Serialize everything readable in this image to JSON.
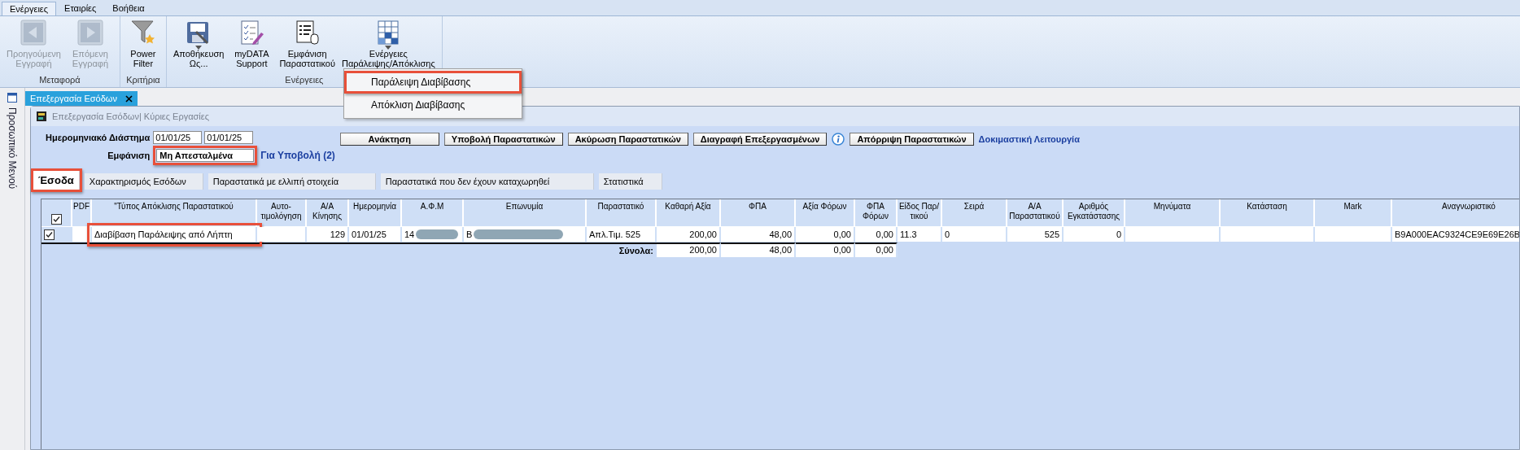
{
  "ribbon": {
    "tabs": [
      {
        "label": "Ενέργειες",
        "selected": true
      },
      {
        "label": "Εταιρίες",
        "selected": false
      },
      {
        "label": "Βοήθεια",
        "selected": false
      }
    ],
    "groups": [
      {
        "label": "Μεταφορά",
        "buttons": [
          {
            "lines": [
              "Προηγούμενη",
              "Εγγραφή"
            ],
            "disabled": true,
            "has_menu": false
          },
          {
            "lines": [
              "Επόμενη",
              "Εγγραφή"
            ],
            "disabled": true,
            "has_menu": false
          }
        ]
      },
      {
        "label": "Κριτήρια",
        "buttons": [
          {
            "lines": [
              "Power",
              "Filter"
            ],
            "disabled": false,
            "has_menu": false
          }
        ]
      },
      {
        "label": "Ενέργειες",
        "buttons": [
          {
            "lines": [
              "Αποθήκευση",
              "Ως..."
            ],
            "disabled": false,
            "has_menu": true
          },
          {
            "lines": [
              "myDATA",
              "Support"
            ],
            "disabled": false,
            "has_menu": false
          },
          {
            "lines": [
              "Εμφάνιση",
              "Παραστατικού"
            ],
            "disabled": false,
            "has_menu": false
          },
          {
            "lines": [
              "Ενέργειες",
              "Παράλειψης/Απόκλισης"
            ],
            "disabled": false,
            "has_menu": true
          }
        ]
      }
    ]
  },
  "dropdown": {
    "items": [
      {
        "label": "Παράλειψη Διαβίβασης",
        "highlighted": true
      },
      {
        "label": "Απόκλιση Διαβίβασης",
        "highlighted": false
      }
    ]
  },
  "sidebar": {
    "label": "Προσωπικό Μενού"
  },
  "document_tab": {
    "label": "Επεξεργασία Εσόδων"
  },
  "panel": {
    "title": "Επεξεργασία Εσόδων| Κύριες Εργασίες",
    "date_range": {
      "label": "Ημερομηνιακό Διάστημα",
      "from": "01/01/25",
      "to": "01/01/25"
    },
    "display": {
      "label": "Εμφάνιση",
      "value": "Μη Απεσταλμένα",
      "highlighted": true
    },
    "status_link": "Για Υποβολή (2)",
    "buttons": [
      {
        "label": "Ανάκτηση",
        "info_icon": false
      },
      {
        "label": "Υποβολή Παραστατικών",
        "info_icon": false
      },
      {
        "label": "Ακύρωση Παραστατικών",
        "info_icon": false
      },
      {
        "label": "Διαγραφή Επεξεργασμένων",
        "info_icon": false
      },
      {
        "label": "Απόρριψη Παραστατικών",
        "info_icon": true
      }
    ],
    "mode_label": "Δοκιμαστική Λειτουργία"
  },
  "subtabs": [
    {
      "label": "Έσοδα",
      "selected": true,
      "highlighted": true
    },
    {
      "label": "Χαρακτηρισμός Εσόδων",
      "selected": false,
      "highlighted": false
    },
    {
      "label": "Παραστατικά με ελλιπή στοιχεία",
      "selected": false,
      "highlighted": false
    },
    {
      "label": "Παραστατικά που δεν έχουν καταχωρηθεί",
      "selected": false,
      "highlighted": false
    },
    {
      "label": "Στατιστικά",
      "selected": false,
      "highlighted": false
    }
  ],
  "table": {
    "header_checked": true,
    "columns": [
      "PDF",
      "\"Τύπος Απόκλισης Παραστατικού",
      "Αυτο-τιμολόγηση",
      "Α/Α Κίνησης",
      "Ημερομηνία",
      "Α.Φ.Μ",
      "Επωνυμία",
      "Παραστατικό",
      "Καθαρή Αξία",
      "ΦΠΑ",
      "Αξία Φόρων",
      "ΦΠΑ Φόρων",
      "Είδος Παρ/τικού",
      "Σειρά",
      "Α/Α Παραστατικού",
      "Αριθμός Εγκατάστασης",
      "Μηνύματα",
      "Κατάσταση",
      "Mark",
      "Αναγνωριστικό"
    ],
    "rows": [
      {
        "checked": true,
        "cells": [
          {
            "text": "",
            "redacted": false,
            "highlighted": false
          },
          {
            "text": "Διαβίβαση Παράλειψης από Λήπτη",
            "redacted": false,
            "highlighted": true
          },
          {
            "text": "",
            "redacted": false,
            "highlighted": false
          },
          {
            "text": "129",
            "redacted": false,
            "highlighted": false
          },
          {
            "text": "01/01/25",
            "redacted": false,
            "highlighted": false
          },
          {
            "text": "14",
            "redacted": true,
            "highlighted": false
          },
          {
            "text": "Β",
            "redacted": true,
            "highlighted": false
          },
          {
            "text": "Απλ.Τιμ. 525",
            "redacted": false,
            "highlighted": false
          },
          {
            "text": "200,00",
            "redacted": false,
            "highlighted": false
          },
          {
            "text": "48,00",
            "redacted": false,
            "highlighted": false
          },
          {
            "text": "0,00",
            "redacted": false,
            "highlighted": false
          },
          {
            "text": "0,00",
            "redacted": false,
            "highlighted": false
          },
          {
            "text": "11.3",
            "redacted": false,
            "highlighted": false
          },
          {
            "text": "0",
            "redacted": false,
            "highlighted": false
          },
          {
            "text": "525",
            "redacted": false,
            "highlighted": false
          },
          {
            "text": "0",
            "redacted": false,
            "highlighted": false
          },
          {
            "text": "",
            "redacted": false,
            "highlighted": false
          },
          {
            "text": "",
            "redacted": false,
            "highlighted": false
          },
          {
            "text": "",
            "redacted": false,
            "highlighted": false
          },
          {
            "text": "B9A000EAC9324CE9E69E26B",
            "redacted": false,
            "highlighted": false
          }
        ]
      }
    ],
    "totals": {
      "label": "Σύνολα:",
      "values": [
        "200,00",
        "48,00",
        "0,00",
        "0,00"
      ]
    }
  }
}
